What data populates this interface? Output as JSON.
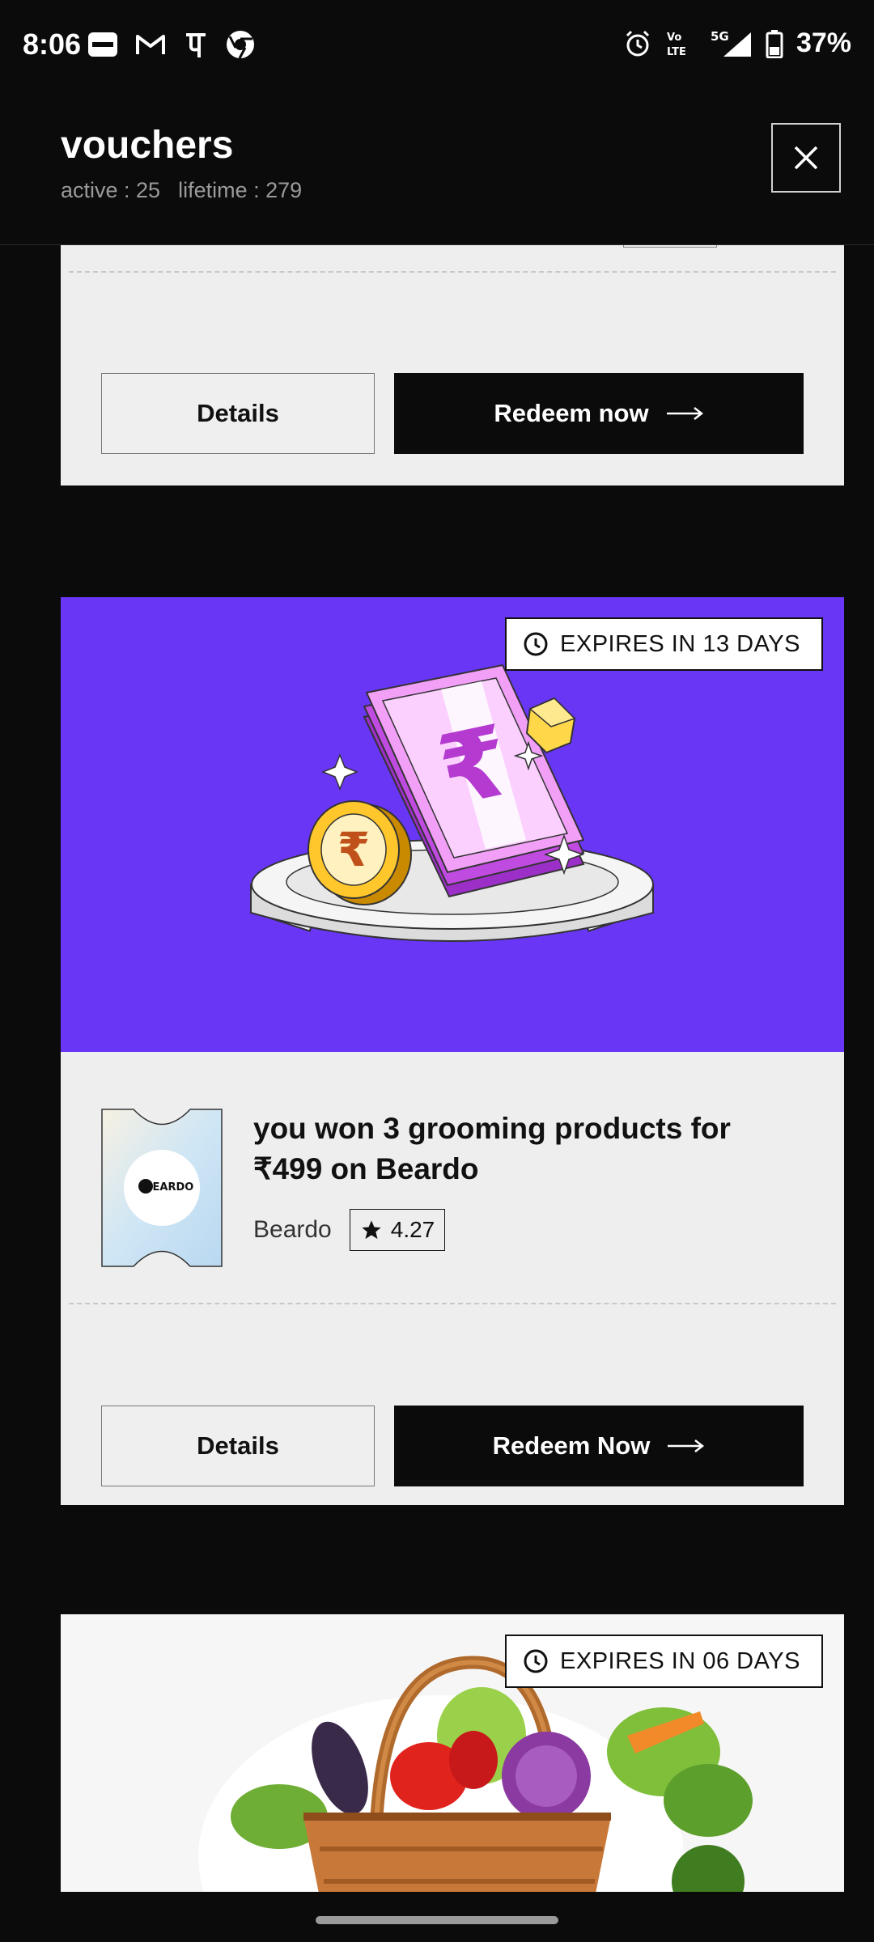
{
  "status_bar": {
    "time": "8:06",
    "left_icons": [
      "paytm-icon",
      "gmail-icon",
      "phonepe-icon",
      "chrome-icon"
    ],
    "right_icons": [
      "alarm-icon",
      "volte-icon",
      "5g-signal-icon",
      "battery-icon"
    ],
    "battery": "37%"
  },
  "header": {
    "title": "vouchers",
    "active": "active : 25",
    "lifetime": "lifetime : 279",
    "close_icon": "close-icon"
  },
  "cards": [
    {
      "details_label": "Details",
      "redeem_label": "Redeem now"
    },
    {
      "expiry": "EXPIRES IN 13 DAYS",
      "hero_color": "#6a36f6",
      "title": "you won 3 grooming products for ₹499 on Beardo",
      "brand": "Beardo",
      "logo_text": "BEARDO",
      "rating": "4.27",
      "details_label": "Details",
      "redeem_label": "Redeem Now"
    },
    {
      "expiry": "EXPIRES IN 06 DAYS"
    }
  ]
}
